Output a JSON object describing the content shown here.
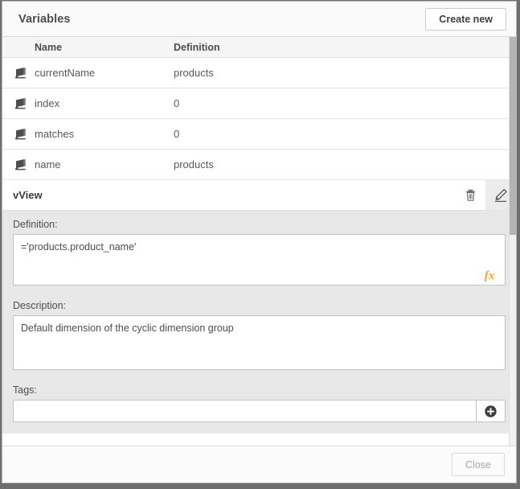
{
  "dialog": {
    "title": "Variables",
    "create_button": "Create new",
    "close_button": "Close"
  },
  "table": {
    "columns": [
      "Name",
      "Definition"
    ],
    "rows": [
      {
        "icon": "variable-icon",
        "name": "currentName",
        "definition": "products"
      },
      {
        "icon": "variable-icon",
        "name": "index",
        "definition": "0"
      },
      {
        "icon": "variable-icon",
        "name": "matches",
        "definition": "0"
      },
      {
        "icon": "variable-icon",
        "name": "name",
        "definition": "products"
      }
    ]
  },
  "selected_variable": {
    "name": "vView",
    "delete_icon": "trash-icon",
    "edit_icon": "pencil-icon",
    "definition_label": "Definition:",
    "definition_value": "='products.product_name'",
    "definition_fx_icon": "fx-icon",
    "description_label": "Description:",
    "description_value": "Default dimension of the cyclic dimension group",
    "tags_label": "Tags:",
    "tags_value": "",
    "tags_placeholder": "",
    "tags_add_icon": "plus-circle-icon"
  },
  "colors": {
    "accent_fx": "#f3a43c",
    "panel_bg": "#e8e8e8",
    "header_bg": "#fafafa",
    "text": "#4d4d4d"
  }
}
